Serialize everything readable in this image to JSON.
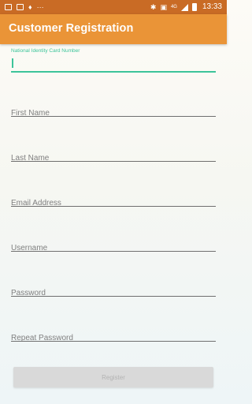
{
  "status_bar": {
    "time": "13:33",
    "left_icons": [
      "message-icon",
      "gmail-icon",
      "mic-icon",
      "more-icon"
    ],
    "right_icons": [
      "bluetooth-icon",
      "vibrate-icon",
      "network-type-icon",
      "signal-icon",
      "battery-icon"
    ],
    "network_label": "4G"
  },
  "app_bar": {
    "title": "Customer Registration",
    "color": "#ea9437"
  },
  "form": {
    "id_field": {
      "label": "National Identity Card Number",
      "value": ""
    },
    "first_name": {
      "placeholder": "First Name"
    },
    "last_name": {
      "placeholder": "Last Name"
    },
    "email": {
      "placeholder": "Email Address"
    },
    "username": {
      "placeholder": "Username"
    },
    "password": {
      "placeholder": "Password"
    },
    "repeat_password": {
      "placeholder": "Repeat Password"
    },
    "accent_color": "#3cc49a"
  },
  "register_button": {
    "label": "Register",
    "enabled": false
  }
}
